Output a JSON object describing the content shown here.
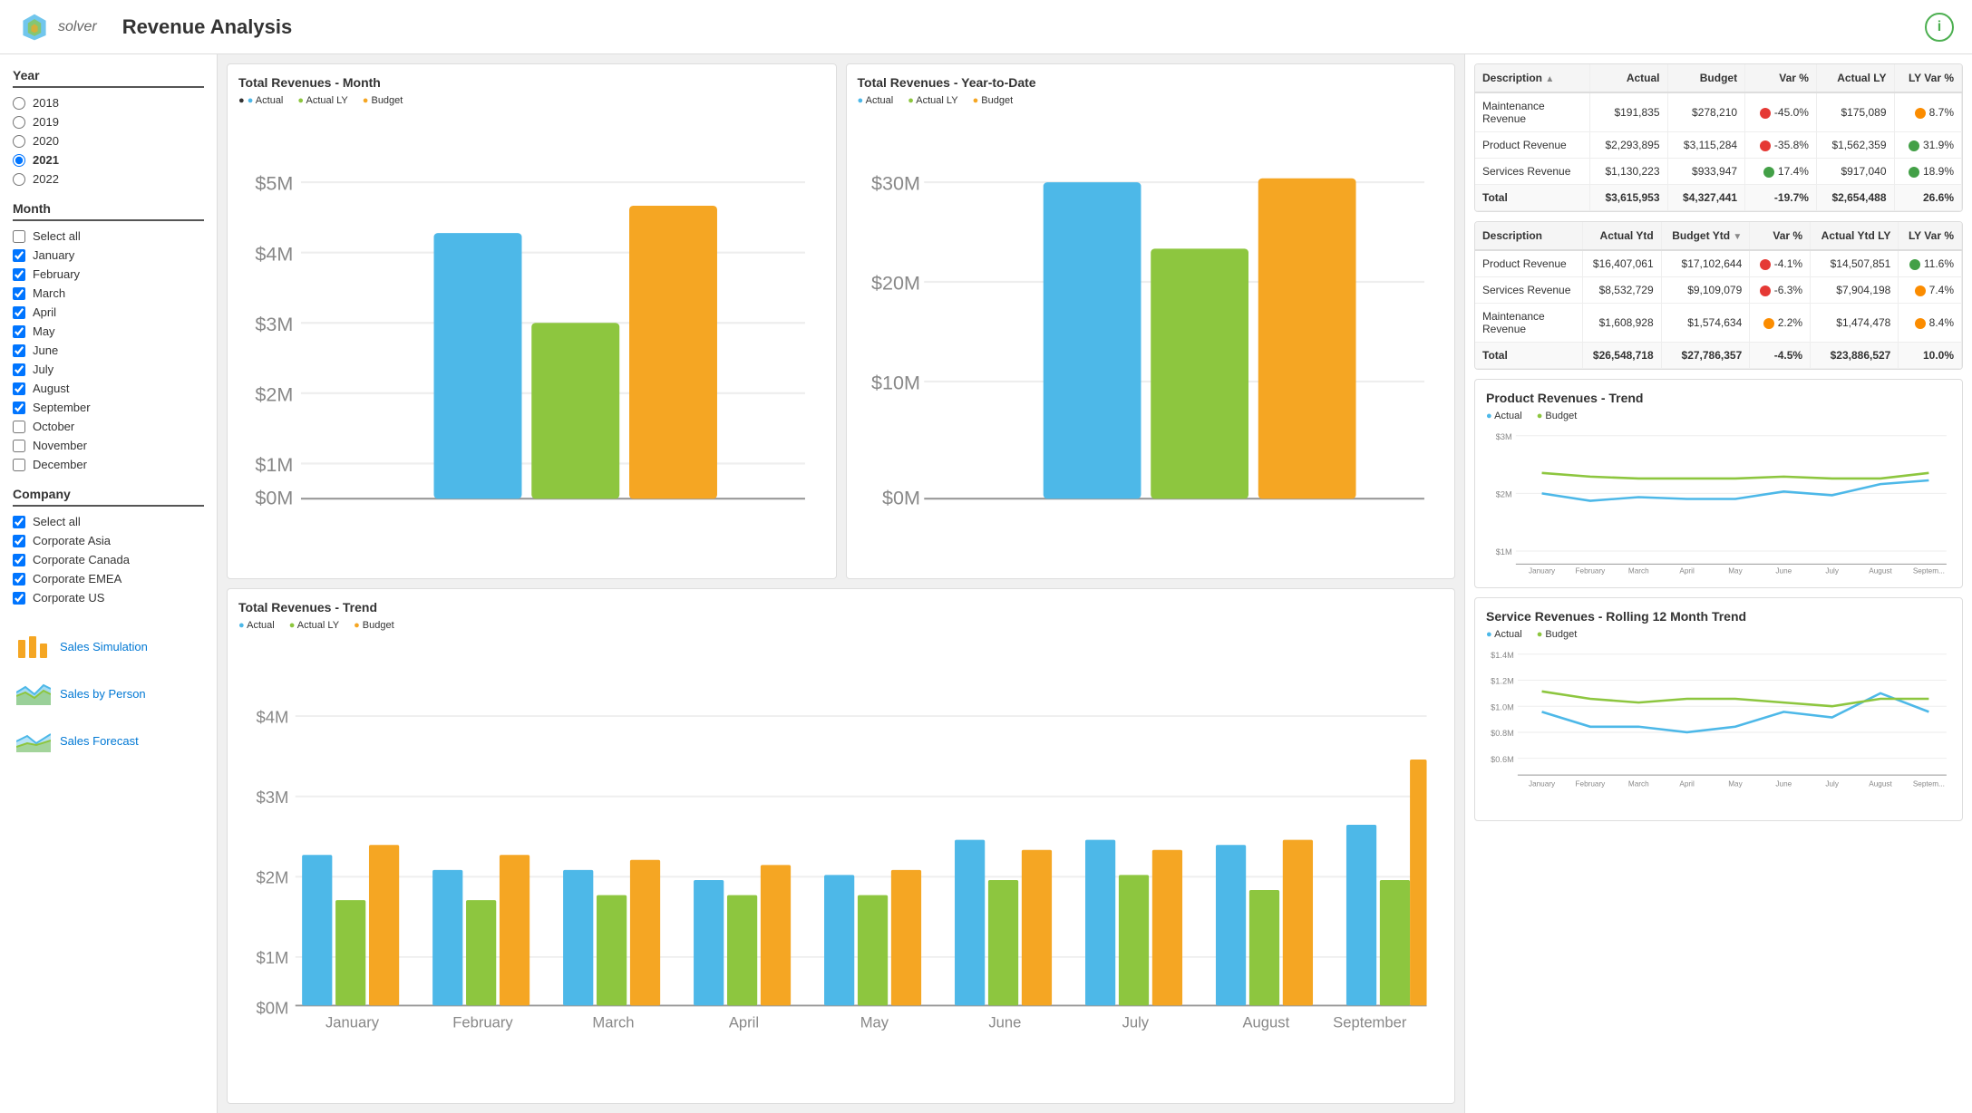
{
  "header": {
    "logo_text": "solver",
    "title": "Revenue Analysis",
    "info_label": "i"
  },
  "sidebar": {
    "year_section": "Year",
    "years": [
      {
        "value": "2018",
        "checked": false
      },
      {
        "value": "2019",
        "checked": false
      },
      {
        "value": "2020",
        "checked": false
      },
      {
        "value": "2021",
        "checked": true
      },
      {
        "value": "2022",
        "checked": false
      }
    ],
    "month_section": "Month",
    "months": [
      {
        "label": "Select all",
        "checked": false,
        "indeterminate": true
      },
      {
        "label": "January",
        "checked": true
      },
      {
        "label": "February",
        "checked": true
      },
      {
        "label": "March",
        "checked": true
      },
      {
        "label": "April",
        "checked": true
      },
      {
        "label": "May",
        "checked": true
      },
      {
        "label": "June",
        "checked": true
      },
      {
        "label": "July",
        "checked": true
      },
      {
        "label": "August",
        "checked": true
      },
      {
        "label": "September",
        "checked": true
      },
      {
        "label": "October",
        "checked": false
      },
      {
        "label": "November",
        "checked": false
      },
      {
        "label": "December",
        "checked": false
      }
    ],
    "company_section": "Company",
    "companies": [
      {
        "label": "Select all",
        "checked": true
      },
      {
        "label": "Corporate Asia",
        "checked": true
      },
      {
        "label": "Corporate Canada",
        "checked": true
      },
      {
        "label": "Corporate EMEA",
        "checked": true
      },
      {
        "label": "Corporate US",
        "checked": true
      }
    ],
    "nav_items": [
      {
        "label": "Sales Simulation",
        "icon": "bar-chart"
      },
      {
        "label": "Sales by Person",
        "icon": "area-chart"
      },
      {
        "label": "Sales Forecast",
        "icon": "forecast-chart"
      }
    ]
  },
  "total_rev_month": {
    "title": "Total Revenues - Month",
    "legend": [
      {
        "label": "Actual",
        "color": "#4db8e8"
      },
      {
        "label": "Actual LY",
        "color": "#8dc63f"
      },
      {
        "label": "Budget",
        "color": "#f5a623"
      }
    ],
    "y_labels": [
      "$5M",
      "$4M",
      "$3M",
      "$2M",
      "$1M",
      "$0M"
    ],
    "bars": [
      {
        "actual": 75,
        "actual_ly": 55,
        "budget": 85
      }
    ]
  },
  "total_rev_ytd": {
    "title": "Total Revenues - Year-to-Date",
    "legend": [
      {
        "label": "Actual",
        "color": "#4db8e8"
      },
      {
        "label": "Actual LY",
        "color": "#8dc63f"
      },
      {
        "label": "Budget",
        "color": "#f5a623"
      }
    ],
    "y_labels": [
      "$30M",
      "$20M",
      "$10M",
      "$0M"
    ],
    "bars": [
      {
        "actual": 90,
        "actual_ly": 72,
        "budget": 95
      }
    ]
  },
  "total_rev_trend": {
    "title": "Total Revenues - Trend",
    "legend": [
      {
        "label": "Actual",
        "color": "#4db8e8"
      },
      {
        "label": "Actual LY",
        "color": "#8dc63f"
      },
      {
        "label": "Budget",
        "color": "#f5a623"
      }
    ],
    "x_labels": [
      "January",
      "February",
      "March",
      "April",
      "May",
      "June",
      "July",
      "August",
      "September"
    ],
    "y_labels": [
      "$4M",
      "$3M",
      "$2M",
      "$1M",
      "$0M"
    ],
    "actual_data": [
      60,
      54,
      54,
      50,
      52,
      66,
      66,
      64,
      72
    ],
    "actual_ly_data": [
      42,
      42,
      44,
      44,
      44,
      50,
      52,
      46,
      50
    ],
    "budget_data": [
      64,
      60,
      58,
      56,
      58,
      62,
      62,
      66,
      84
    ]
  },
  "product_rev_trend": {
    "title": "Product Revenues - Trend",
    "legend": [
      {
        "label": "Actual",
        "color": "#4db8e8"
      },
      {
        "label": "Budget",
        "color": "#8dc63f"
      }
    ],
    "x_labels": [
      "January",
      "February",
      "March",
      "April",
      "May",
      "June",
      "July",
      "August",
      "Septem..."
    ],
    "y_labels": [
      "$3M",
      "$2M",
      "$1M"
    ],
    "actual_data": [
      62,
      56,
      60,
      58,
      58,
      64,
      60,
      70,
      72
    ],
    "budget_data": [
      74,
      70,
      68,
      68,
      68,
      70,
      68,
      68,
      72
    ]
  },
  "service_rev_trend": {
    "title": "Service Revenues - Rolling 12 Month Trend",
    "legend": [
      {
        "label": "Actual",
        "color": "#4db8e8"
      },
      {
        "label": "Budget",
        "color": "#8dc63f"
      }
    ],
    "x_labels": [
      "January",
      "February",
      "March",
      "April",
      "May",
      "June",
      "July",
      "August",
      "Septem..."
    ],
    "y_labels": [
      "$1.4M",
      "$1.2M",
      "$1.0M",
      "$0.8M",
      "$0.6M"
    ],
    "actual_data": [
      46,
      38,
      38,
      36,
      38,
      50,
      46,
      56,
      48
    ],
    "budget_data": [
      56,
      52,
      50,
      52,
      52,
      50,
      48,
      50,
      52
    ]
  },
  "table1": {
    "title": "",
    "columns": [
      "Description",
      "Actual",
      "Budget",
      "Var %",
      "Actual LY",
      "LY Var %"
    ],
    "rows": [
      {
        "description": "Maintenance Revenue",
        "actual": "$191,835",
        "budget": "$278,210",
        "var_pct": "-45.0%",
        "var_status": "red",
        "actual_ly": "$175,089",
        "ly_var_pct": "8.7%",
        "ly_status": "orange"
      },
      {
        "description": "Product Revenue",
        "actual": "$2,293,895",
        "budget": "$3,115,284",
        "var_pct": "-35.8%",
        "var_status": "red",
        "actual_ly": "$1,562,359",
        "ly_var_pct": "31.9%",
        "ly_status": "green"
      },
      {
        "description": "Services Revenue",
        "actual": "$1,130,223",
        "budget": "$933,947",
        "var_pct": "17.4%",
        "var_status": "green",
        "actual_ly": "$917,040",
        "ly_var_pct": "18.9%",
        "ly_status": "green"
      }
    ],
    "total": {
      "label": "Total",
      "actual": "$3,615,953",
      "budget": "$4,327,441",
      "var_pct": "-19.7%",
      "actual_ly": "$2,654,488",
      "ly_var_pct": "26.6%"
    }
  },
  "table2": {
    "columns": [
      "Description",
      "Actual Ytd",
      "Budget Ytd",
      "Var %",
      "Actual Ytd LY",
      "LY Var %"
    ],
    "rows": [
      {
        "description": "Product Revenue",
        "actual": "$16,407,061",
        "budget": "$17,102,644",
        "var_pct": "-4.1%",
        "var_status": "red",
        "actual_ly": "$14,507,851",
        "ly_var_pct": "11.6%",
        "ly_status": "green"
      },
      {
        "description": "Services Revenue",
        "actual": "$8,532,729",
        "budget": "$9,109,079",
        "var_pct": "-6.3%",
        "var_status": "red",
        "actual_ly": "$7,904,198",
        "ly_var_pct": "7.4%",
        "ly_status": "orange"
      },
      {
        "description": "Maintenance Revenue",
        "actual": "$1,608,928",
        "budget": "$1,574,634",
        "var_pct": "2.2%",
        "var_status": "orange",
        "actual_ly": "$1,474,478",
        "ly_var_pct": "8.4%",
        "ly_status": "orange"
      }
    ],
    "total": {
      "label": "Total",
      "actual": "$26,548,718",
      "budget": "$27,786,357",
      "var_pct": "-4.5%",
      "actual_ly": "$23,886,527",
      "ly_var_pct": "10.0%"
    }
  }
}
